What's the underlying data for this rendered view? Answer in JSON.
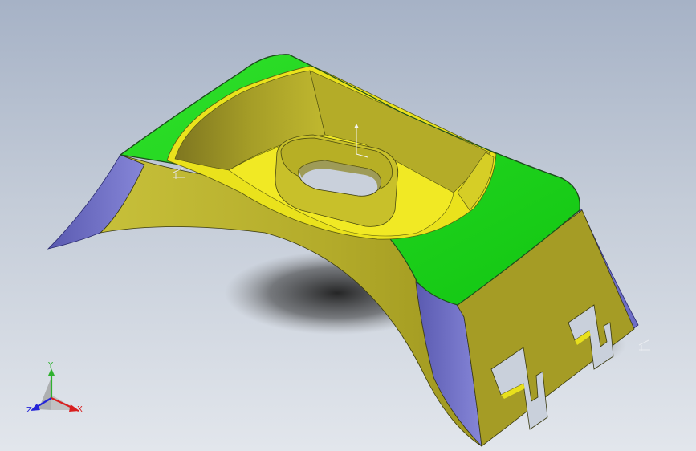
{
  "viewport": {
    "background_top": "#a6b2c6",
    "background_bottom": "#e2e6ec"
  },
  "model": {
    "colors": {
      "top_face": "#19d21a",
      "side_face": "#b9b12a",
      "side_face_dark": "#8e8420",
      "inner_face": "#ece41a",
      "end_face": "#6e6ec8",
      "edge": "#1d4f1d"
    }
  },
  "triad": {
    "x_label": "X",
    "y_label": "Y",
    "z_label": "Z",
    "x_color": "#d81f1f",
    "y_color": "#2fb12f",
    "z_color": "#2424d8"
  }
}
